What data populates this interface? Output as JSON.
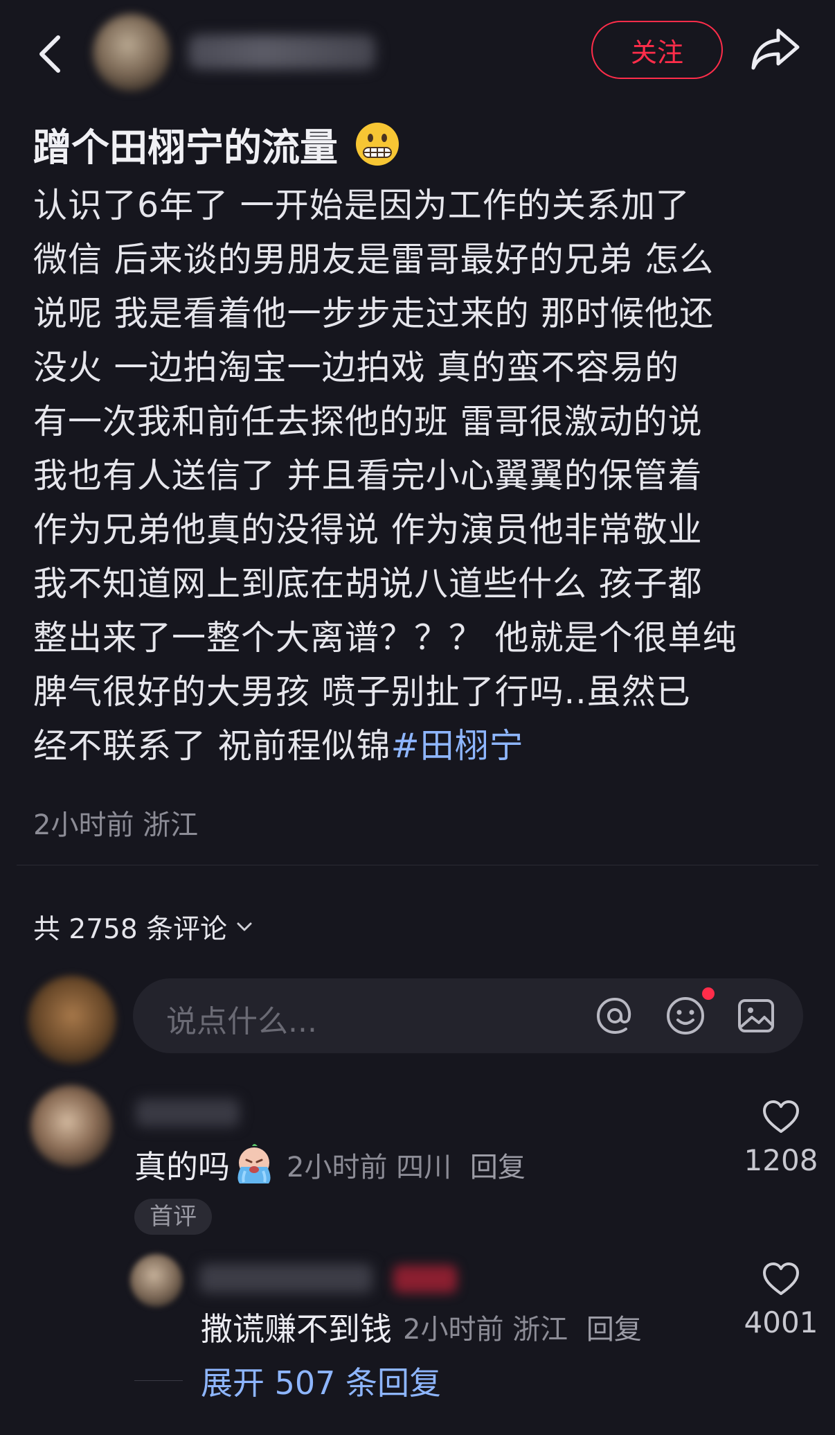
{
  "header": {
    "follow_label": "关注"
  },
  "post": {
    "title": "蹭个田栩宁的流量",
    "title_emoji": "grimacing-face",
    "body": "认识了6年了 一开始是因为工作的关系加了\n微信 后来谈的男朋友是雷哥最好的兄弟 怎么\n说呢 我是看着他一步步走过来的 那时候他还\n没火 一边拍淘宝一边拍戏 真的蛮不容易的\n有一次我和前任去探他的班 雷哥很激动的说\n我也有人送信了 并且看完小心翼翼的保管着\n作为兄弟他真的没得说 作为演员他非常敬业\n我不知道网上到底在胡说八道些什么 孩子都\n整出来了一整个大离谱？？？ 他就是个很单纯\n脾气很好的大男孩  喷子别扯了行吗..虽然已\n经不联系了 祝前程似锦",
    "hashtag": "#田栩宁",
    "time": "2小时前",
    "location": "浙江"
  },
  "comments_section": {
    "count_label": "共 2758 条评论",
    "input_placeholder": "说点什么..."
  },
  "comments": [
    {
      "text": "真的吗",
      "emoji": "crying-face",
      "time": "2小时前",
      "location": "四川",
      "reply_label": "回复",
      "badge": "首评",
      "likes": "1208"
    },
    {
      "text": "撒谎赚不到钱",
      "time": "2小时前",
      "location": "浙江",
      "reply_label": "回复",
      "likes": "4001",
      "expand_label": "展开 507 条回复"
    }
  ],
  "colors": {
    "background": "#16161e",
    "accent": "#ff2d4a",
    "link": "#8eb6ff"
  }
}
